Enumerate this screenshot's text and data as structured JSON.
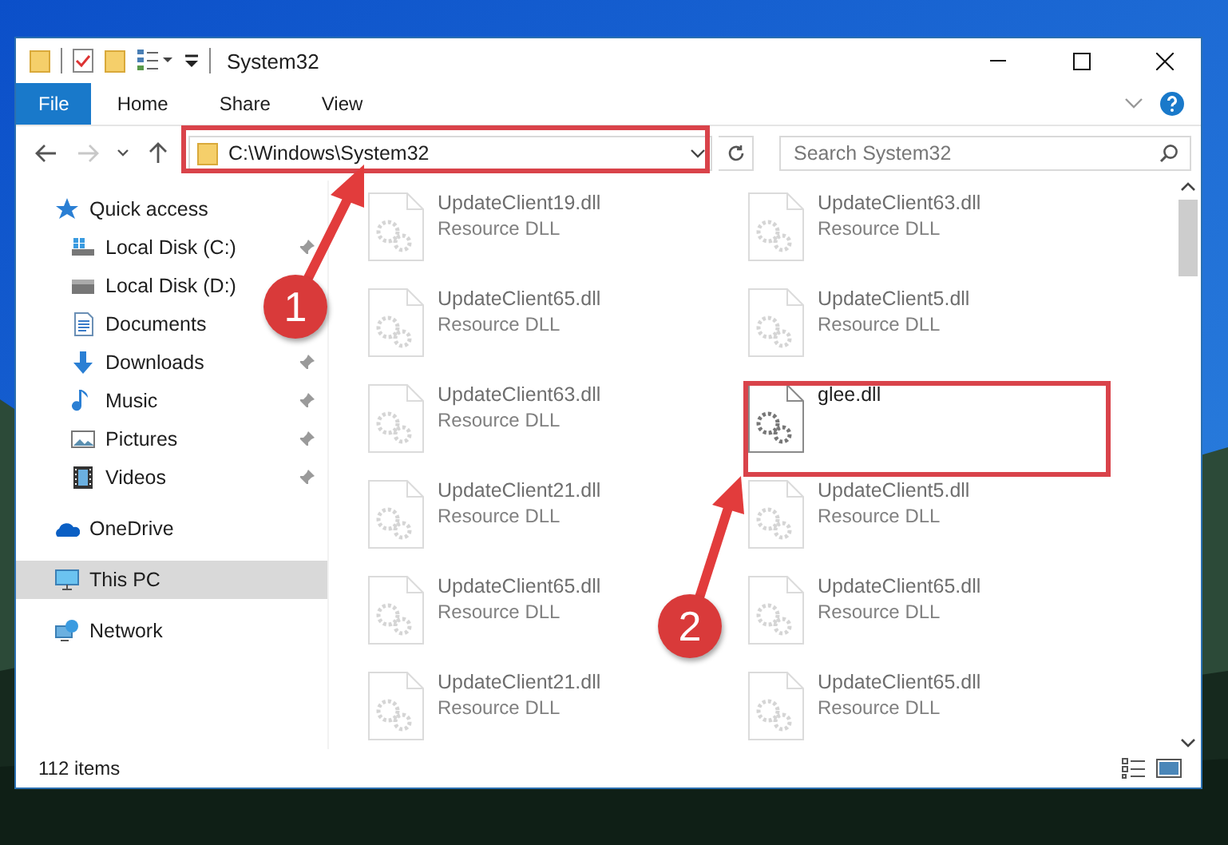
{
  "window": {
    "title": "System32"
  },
  "ribbon": {
    "tabs": [
      {
        "label": "File",
        "kind": "menu"
      },
      {
        "label": "Home",
        "kind": "tab"
      },
      {
        "label": "Share",
        "kind": "tab"
      },
      {
        "label": "View",
        "kind": "tab"
      }
    ]
  },
  "address_bar": {
    "path": "C:\\Windows\\System32"
  },
  "search": {
    "placeholder": "Search System32"
  },
  "navigation": {
    "items": [
      {
        "label": "Quick access",
        "kind": "header",
        "pinned": false,
        "selected": false
      },
      {
        "label": "Local Disk (C:)",
        "kind": "item",
        "pinned": true,
        "selected": false
      },
      {
        "label": "Local Disk (D:)",
        "kind": "item",
        "pinned": false,
        "selected": false
      },
      {
        "label": "Documents",
        "kind": "item",
        "pinned": false,
        "selected": false
      },
      {
        "label": "Downloads",
        "kind": "item",
        "pinned": true,
        "selected": false
      },
      {
        "label": "Music",
        "kind": "item",
        "pinned": true,
        "selected": false
      },
      {
        "label": "Pictures",
        "kind": "item",
        "pinned": true,
        "selected": false
      },
      {
        "label": "Videos",
        "kind": "item",
        "pinned": true,
        "selected": false
      },
      {
        "label": "OneDrive",
        "kind": "header",
        "pinned": false,
        "selected": false
      },
      {
        "label": "This PC",
        "kind": "header",
        "pinned": false,
        "selected": true
      },
      {
        "label": "Network",
        "kind": "header",
        "pinned": false,
        "selected": false
      }
    ]
  },
  "files": [
    {
      "name": "UpdateClient19.dll",
      "type": "Resource DLL",
      "dimmed": true
    },
    {
      "name": "UpdateClient63.dll",
      "type": "Resource DLL",
      "dimmed": true
    },
    {
      "name": "UpdateClient65.dll",
      "type": "Resource DLL",
      "dimmed": true
    },
    {
      "name": "UpdateClient5.dll",
      "type": "Resource DLL",
      "dimmed": true
    },
    {
      "name": "UpdateClient63.dll",
      "type": "Resource DLL",
      "dimmed": true
    },
    {
      "name": "glee.dll",
      "dimmed": false
    },
    {
      "name": "UpdateClient21.dll",
      "type": "Resource DLL",
      "dimmed": true
    },
    {
      "name": "UpdateClient5.dll",
      "type": "Resource DLL",
      "dimmed": true
    },
    {
      "name": "UpdateClient65.dll",
      "type": "Resource DLL",
      "dimmed": true
    },
    {
      "name": "UpdateClient65.dll",
      "type": "Resource DLL",
      "dimmed": true
    },
    {
      "name": "UpdateClient21.dll",
      "type": "Resource DLL",
      "dimmed": true
    },
    {
      "name": "UpdateClient65.dll",
      "type": "Resource DLL",
      "dimmed": true
    }
  ],
  "status_bar": {
    "item_count": "112 items"
  },
  "annotations": [
    {
      "label": "1"
    },
    {
      "label": "2"
    }
  ]
}
